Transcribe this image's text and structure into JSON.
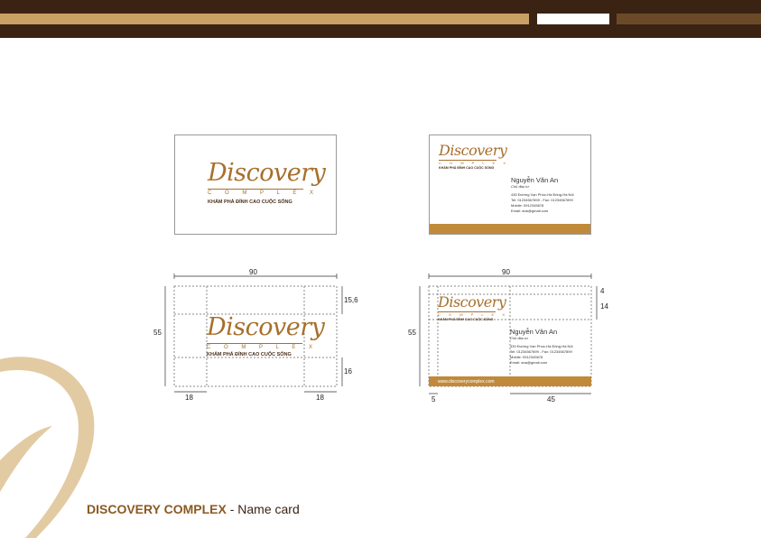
{
  "logo": {
    "wordmark": "Discovery",
    "subword": "C O M P L E X",
    "tagline": "KHÁM PHÁ ĐỈNH CAO CUỘC SỐNG"
  },
  "contact": {
    "name": "Nguyễn Văn An",
    "role": "Chủ đầu tư",
    "address": "430 Đường Vạn Phúc-Hà Đông-Hà Nội",
    "phone": "Tel: 01234567899 - Fax: 01234567899",
    "mobile": "Mobile: 0912345678",
    "email": "Email: ana@gmail.com",
    "website": "www.discoverycomplex.com"
  },
  "dimensions": {
    "width": "90",
    "height": "55",
    "top_margin_front": "15,6",
    "bottom_margin_front": "16",
    "side_margin_left": "18",
    "side_margin_right": "18",
    "top_offset_back": "4",
    "logo_height_back": "14",
    "left_margin_back": "5",
    "text_column_back": "45"
  },
  "footer": {
    "brand": "DISCOVERY COMPLEX",
    "separator": " - ",
    "subtitle": "Name card"
  },
  "colors": {
    "header_dark": "#3b2313",
    "header_gold": "#c8a064",
    "brand_gold": "#a86f2c",
    "band": "#c08a3a",
    "swoosh": "#e2cba3"
  }
}
